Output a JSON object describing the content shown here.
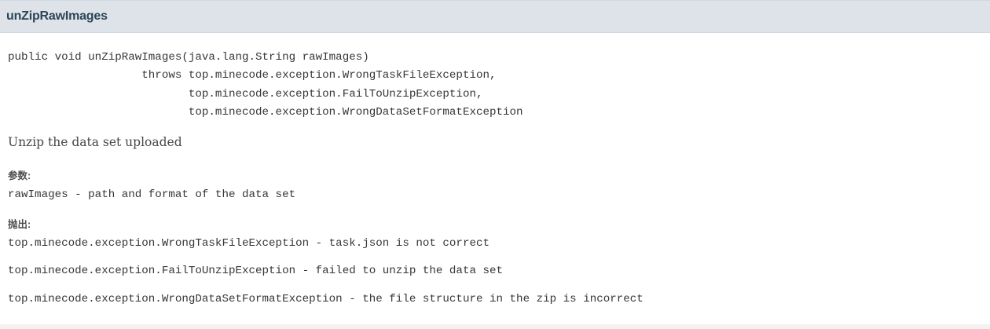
{
  "method": {
    "name": "unZipRawImages",
    "signature": [
      "public void unZipRawImages(java.lang.String rawImages)",
      "                    throws top.minecode.exception.WrongTaskFileException,",
      "                           top.minecode.exception.FailToUnzipException,",
      "                           top.minecode.exception.WrongDataSetFormatException"
    ],
    "description": "Unzip the data set uploaded",
    "params_label": "参数:",
    "params": [
      "rawImages - path and format of the data set"
    ],
    "throws_label": "抛出:",
    "throws": [
      "top.minecode.exception.WrongTaskFileException - task.json is not correct",
      "top.minecode.exception.FailToUnzipException - failed to unzip the data set",
      "top.minecode.exception.WrongDataSetFormatException - the file structure in the zip is incorrect"
    ]
  }
}
